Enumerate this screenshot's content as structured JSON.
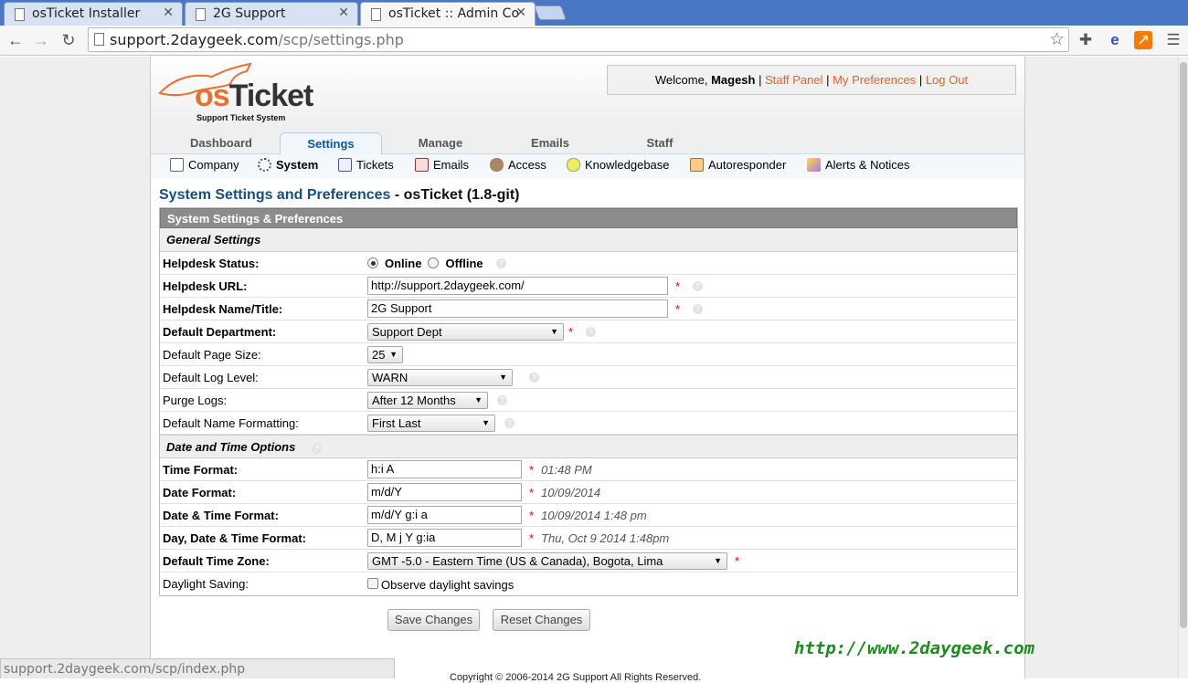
{
  "browser": {
    "tabs": [
      {
        "title": "osTicket Installer"
      },
      {
        "title": "2G Support"
      },
      {
        "title": "osTicket :: Admin Co"
      }
    ],
    "url_host": "support.2daygeek.com",
    "url_path": "/scp/settings.php",
    "status_url": "support.2daygeek.com/scp/index.php"
  },
  "header": {
    "logo_os": "os",
    "logo_ticket": "Ticket",
    "logo_sub": "Support Ticket System",
    "welcome": "Welcome,",
    "user": "Magesh",
    "sep": "|",
    "staff_panel": "Staff Panel",
    "my_preferences": "My Preferences",
    "log_out": "Log Out"
  },
  "nav": {
    "dashboard": "Dashboard",
    "settings": "Settings",
    "manage": "Manage",
    "emails": "Emails",
    "staff": "Staff"
  },
  "subnav": {
    "company": "Company",
    "system": "System",
    "tickets": "Tickets",
    "emails": "Emails",
    "access": "Access",
    "knowledgebase": "Knowledgebase",
    "autoresponder": "Autoresponder",
    "alerts": "Alerts & Notices"
  },
  "page": {
    "title": "System Settings and Preferences",
    "dash": " - ",
    "version": "osTicket (1.8-git)",
    "section": "System Settings & Preferences",
    "general": "General Settings",
    "datetime": "Date and Time Options"
  },
  "fields": {
    "status_label": "Helpdesk Status:",
    "online": "Online",
    "offline": "Offline",
    "url_label": "Helpdesk URL:",
    "url_value": "http://support.2daygeek.com/",
    "name_label": "Helpdesk Name/Title:",
    "name_value": "2G Support",
    "dept_label": "Default Department:",
    "dept_value": "Support Dept",
    "pagesize_label": "Default Page Size:",
    "pagesize_value": "25",
    "loglevel_label": "Default Log Level:",
    "loglevel_value": "WARN",
    "purge_label": "Purge Logs:",
    "purge_value": "After 12 Months",
    "nameformat_label": "Default Name Formatting:",
    "nameformat_value": "First Last",
    "timefmt_label": "Time Format:",
    "timefmt_value": "h:i A",
    "timefmt_hint": "01:48 PM",
    "datefmt_label": "Date Format:",
    "datefmt_value": "m/d/Y",
    "datefmt_hint": "10/09/2014",
    "dtfmt_label": "Date & Time Format:",
    "dtfmt_value": "m/d/Y g:i a",
    "dtfmt_hint": "10/09/2014 1:48 pm",
    "ddtfmt_label": "Day, Date & Time Format:",
    "ddtfmt_value": "D, M j Y g:ia",
    "ddtfmt_hint": "Thu, Oct 9 2014 1:48pm",
    "tz_label": "Default Time Zone:",
    "tz_value": "GMT -5.0 - Eastern Time (US & Canada), Bogota, Lima",
    "dst_label": "Daylight Saving:",
    "dst_option": "Observe daylight savings",
    "required": "*"
  },
  "buttons": {
    "save": "Save Changes",
    "reset": "Reset Changes"
  },
  "watermark": "http://www.2daygeek.com",
  "footer": "Copyright © 2006-2014 2G Support All Rights Reserved."
}
